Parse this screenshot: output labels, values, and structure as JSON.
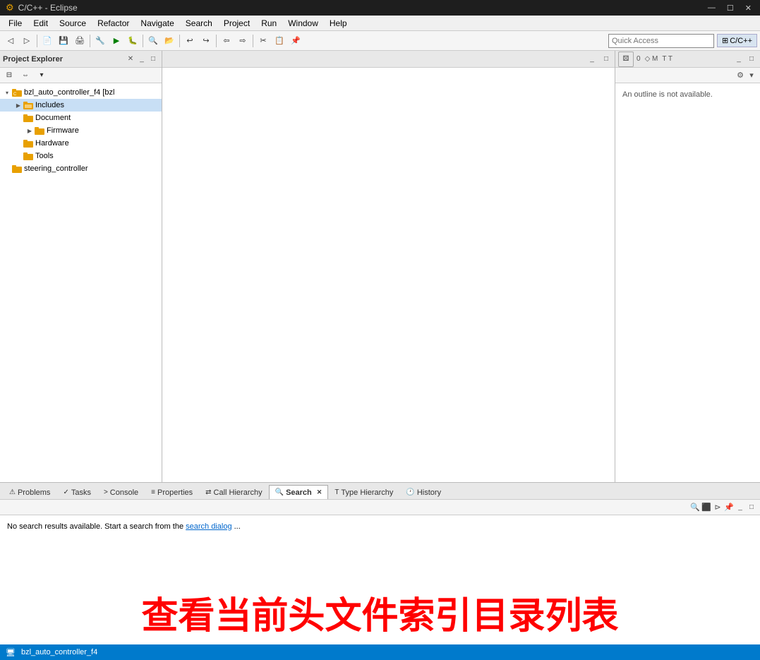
{
  "titlebar": {
    "icon": "⚙",
    "title": "C/C++ - Eclipse",
    "minimize": "—",
    "maximize": "☐",
    "close": "✕"
  },
  "menubar": {
    "items": [
      "File",
      "Edit",
      "Source",
      "Refactor",
      "Navigate",
      "Search",
      "Project",
      "Run",
      "Window",
      "Help"
    ]
  },
  "toolbar": {
    "quick_access_placeholder": "Quick Access",
    "perspective_label": "C/C++"
  },
  "project_explorer": {
    "title": "Project Explorer",
    "tree": [
      {
        "id": "root",
        "label": "bzl_auto_controller_f4 [bzl",
        "indent": 0,
        "expanded": true,
        "icon": "📁",
        "arrow": "▾"
      },
      {
        "id": "includes",
        "label": "Includes",
        "indent": 1,
        "expanded": false,
        "icon": "📂",
        "arrow": "▶",
        "highlighted": true
      },
      {
        "id": "document",
        "label": "Document",
        "indent": 1,
        "expanded": false,
        "icon": "📁",
        "arrow": ""
      },
      {
        "id": "firmware",
        "label": "Firmware",
        "indent": 2,
        "expanded": false,
        "icon": "📁",
        "arrow": "▶"
      },
      {
        "id": "hardware",
        "label": "Hardware",
        "indent": 1,
        "expanded": false,
        "icon": "📁",
        "arrow": ""
      },
      {
        "id": "tools",
        "label": "Tools",
        "indent": 1,
        "expanded": false,
        "icon": "📁",
        "arrow": ""
      },
      {
        "id": "steering",
        "label": "steering_controller",
        "indent": 0,
        "expanded": false,
        "icon": "📁",
        "arrow": ""
      }
    ]
  },
  "outline": {
    "title": "An outline is not available.",
    "buttons": [
      "0",
      "M",
      "T"
    ]
  },
  "bottom_panel": {
    "tabs": [
      {
        "id": "problems",
        "label": "Problems",
        "icon": "⚠"
      },
      {
        "id": "tasks",
        "label": "Tasks",
        "icon": "✓"
      },
      {
        "id": "console",
        "label": "Console",
        "icon": ">"
      },
      {
        "id": "properties",
        "label": "Properties",
        "icon": "≡"
      },
      {
        "id": "callhierarchy",
        "label": "Call Hierarchy",
        "icon": "⇄"
      },
      {
        "id": "search",
        "label": "Search",
        "icon": "🔍",
        "active": true
      },
      {
        "id": "typehierarchy",
        "label": "Type Hierarchy",
        "icon": "T"
      },
      {
        "id": "history",
        "label": "History",
        "icon": "🕐"
      }
    ],
    "search_message": "No search results available. Start a search from the",
    "search_link": "search dialog",
    "search_link_suffix": "..."
  },
  "status_bar": {
    "project": "bzl_auto_controller_f4"
  },
  "watermark": {
    "text": "查看当前头文件索引目录列表"
  }
}
